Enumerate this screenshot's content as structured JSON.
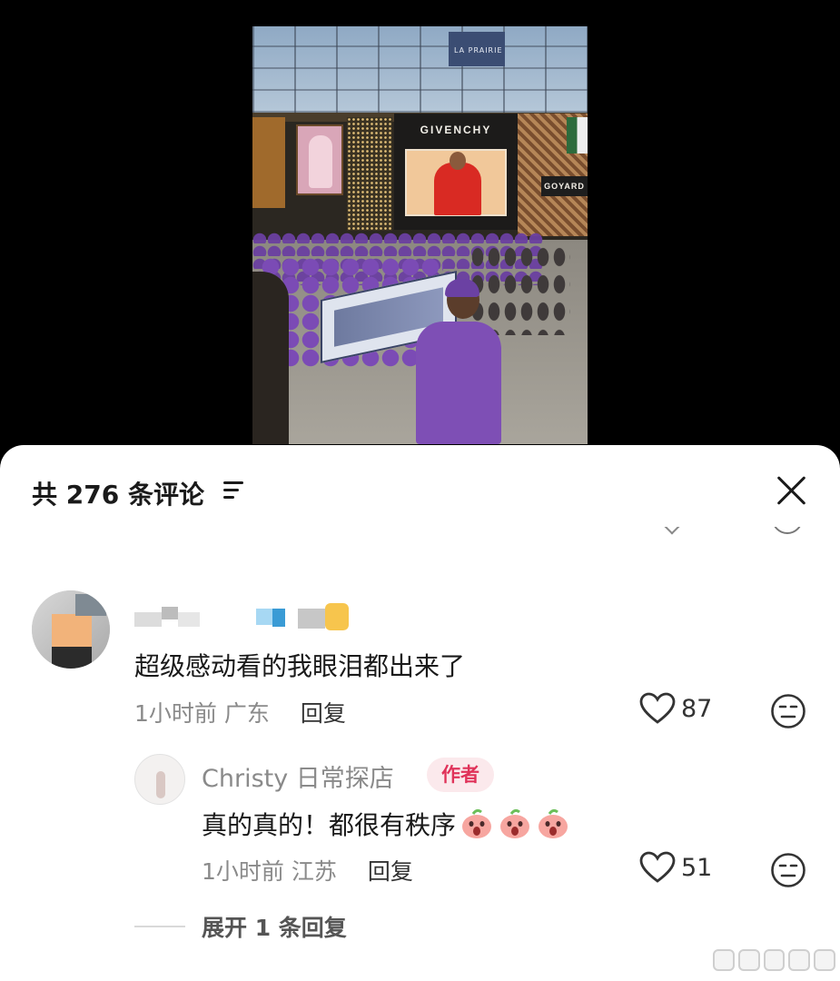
{
  "video": {
    "signs": {
      "givenchy": "GIVENCHY",
      "goyard": "GOYARD",
      "prairie": "LA PRAIRIE"
    }
  },
  "header": {
    "title": "共 276 条评论",
    "sort_icon": "sort-lines-icon",
    "close_icon": "close-x-icon"
  },
  "comments": [
    {
      "username": "",
      "text": "超级感动看的我眼泪都出来了",
      "time": "1小时前",
      "location": "广东",
      "reply_label": "回复",
      "likes": "87",
      "replies": [
        {
          "username": "Christy 日常探店",
          "badge": "作者",
          "text": "真的真的！都很有秩序",
          "time": "1小时前",
          "location": "江苏",
          "reply_label": "回复",
          "likes": "51"
        }
      ],
      "expand_label": "展开 1 条回复"
    }
  ],
  "colors": {
    "badge_bg": "#fbe9ec",
    "badge_text": "#e0335a",
    "meta_text": "#8a8a8a",
    "primary_text": "#1a1a1a"
  }
}
